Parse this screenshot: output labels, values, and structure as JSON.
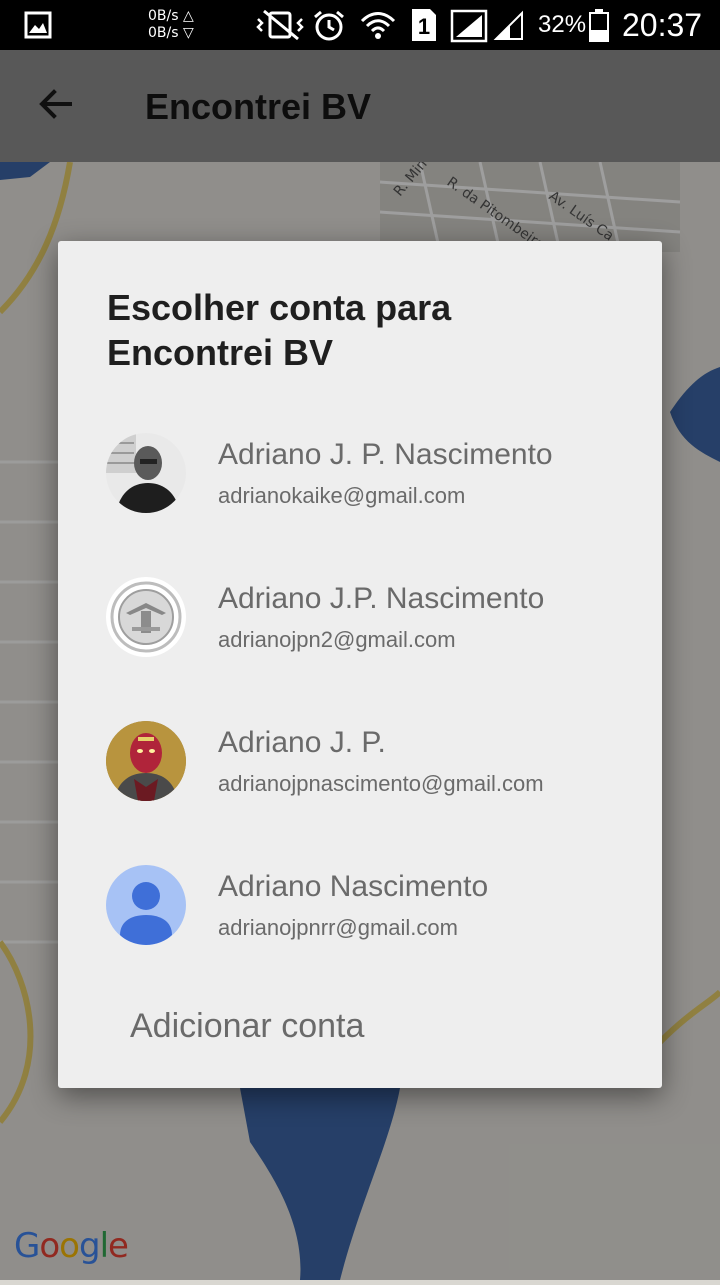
{
  "status_bar": {
    "net_up": "0B/s △",
    "net_down": "0B/s ▽",
    "sim_slot": "1",
    "battery_percent": "32%",
    "time": "20:37"
  },
  "app_bar": {
    "title": "Encontrei BV"
  },
  "map": {
    "street_labels": [
      "R. Min",
      "R. da Pitombeira",
      "Av. Luís Ca"
    ],
    "provider": "Google"
  },
  "dialog": {
    "title": "Escolher conta para Encontrei BV",
    "accounts": [
      {
        "name": "Adriano J. P. Nascimento",
        "email": "adrianokaike@gmail.com"
      },
      {
        "name": "Adriano J.P. Nascimento",
        "email": "adrianojpn2@gmail.com"
      },
      {
        "name": "Adriano J. P.",
        "email": "adrianojpnascimento@gmail.com"
      },
      {
        "name": "Adriano Nascimento",
        "email": "adrianojpnrr@gmail.com"
      }
    ],
    "add_account_label": "Adicionar conta"
  },
  "colors": {
    "map_water": "#3e67a8",
    "map_land": "#e6e4de",
    "default_avatar_bg": "#a7c2f5",
    "default_avatar_fg": "#3f6fd8"
  }
}
